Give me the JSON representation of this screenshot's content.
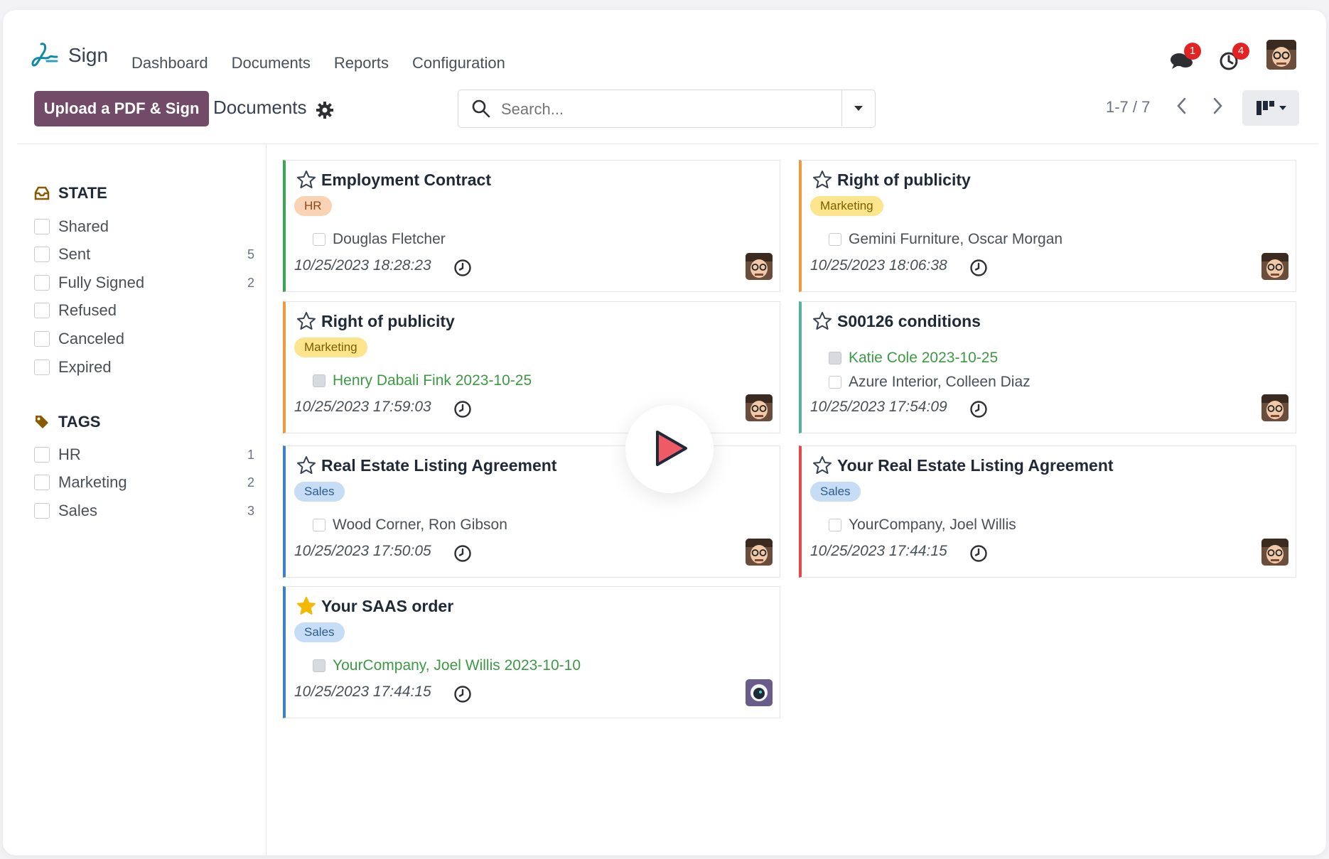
{
  "app": {
    "name": "Sign"
  },
  "nav": {
    "menu": [
      "Dashboard",
      "Documents",
      "Reports",
      "Configuration"
    ],
    "messages_badge": "1",
    "activities_badge": "4"
  },
  "control": {
    "upload_label": "Upload a PDF & Sign",
    "title": "Documents",
    "search_placeholder": "Search...",
    "pager": "1-7 / 7"
  },
  "sidebar": {
    "state_title": "STATE",
    "state_items": [
      {
        "label": "Shared",
        "count": ""
      },
      {
        "label": "Sent",
        "count": "5"
      },
      {
        "label": "Fully Signed",
        "count": "2"
      },
      {
        "label": "Refused",
        "count": ""
      },
      {
        "label": "Canceled",
        "count": ""
      },
      {
        "label": "Expired",
        "count": ""
      }
    ],
    "tags_title": "TAGS",
    "tag_items": [
      {
        "label": "HR",
        "count": "1"
      },
      {
        "label": "Marketing",
        "count": "2"
      },
      {
        "label": "Sales",
        "count": "3"
      }
    ]
  },
  "cards": [
    {
      "title": "Employment Contract",
      "tag": "HR",
      "starred": false,
      "signers": [
        {
          "name": "Douglas Fletcher",
          "signed": false
        }
      ],
      "date": "10/25/2023 18:28:23",
      "border": "#3aa655"
    },
    {
      "title": "Right of publicity",
      "tag": "Marketing",
      "starred": false,
      "signers": [
        {
          "name": "Gemini Furniture, Oscar Morgan",
          "signed": false
        }
      ],
      "date": "10/25/2023 18:06:38",
      "border": "#f0993e"
    },
    {
      "title": "Right of publicity",
      "tag": "Marketing",
      "starred": false,
      "signers": [
        {
          "name": "Henry Dabali Fink 2023-10-25",
          "signed": true
        }
      ],
      "date": "10/25/2023 17:59:03",
      "border": "#f0993e"
    },
    {
      "title": "S00126 conditions",
      "tag": "",
      "starred": false,
      "signers": [
        {
          "name": "Katie Cole 2023-10-25",
          "signed": true
        },
        {
          "name": "Azure Interior, Colleen Diaz",
          "signed": false
        }
      ],
      "date": "10/25/2023 17:54:09",
      "border": "#55b0a0"
    },
    {
      "title": "Real Estate Listing Agreement",
      "tag": "Sales",
      "starred": false,
      "signers": [
        {
          "name": "Wood Corner, Ron Gibson",
          "signed": false
        }
      ],
      "date": "10/25/2023 17:50:05",
      "border": "#3b82c4"
    },
    {
      "title": "Your Real Estate Listing Agreement",
      "tag": "Sales",
      "starred": false,
      "signers": [
        {
          "name": "YourCompany, Joel Willis",
          "signed": false
        }
      ],
      "date": "10/25/2023 17:44:15",
      "border": "#e24a4a"
    },
    {
      "title": "Your SAAS order",
      "tag": "Sales",
      "starred": true,
      "signers": [
        {
          "name": "YourCompany, Joel Willis 2023-10-10",
          "signed": true
        }
      ],
      "date": "10/25/2023 17:44:15",
      "border": "#3b82c4"
    }
  ],
  "tag_colors": {
    "HR": {
      "bg": "#fad2b4",
      "fg": "#8a4b1b"
    },
    "Marketing": {
      "bg": "#fce58c",
      "fg": "#7a5d00"
    },
    "Sales": {
      "bg": "#c7ddf5",
      "fg": "#2d5b8a"
    }
  },
  "icons": {
    "logo": "sign-logo-icon",
    "messages": "chat-bubbles-icon",
    "activities": "clock-icon",
    "gear": "gear-icon",
    "search": "search-icon",
    "star": "star-icon",
    "clock": "clock-icon",
    "play": "play-icon",
    "view": "kanban-view-icon"
  }
}
